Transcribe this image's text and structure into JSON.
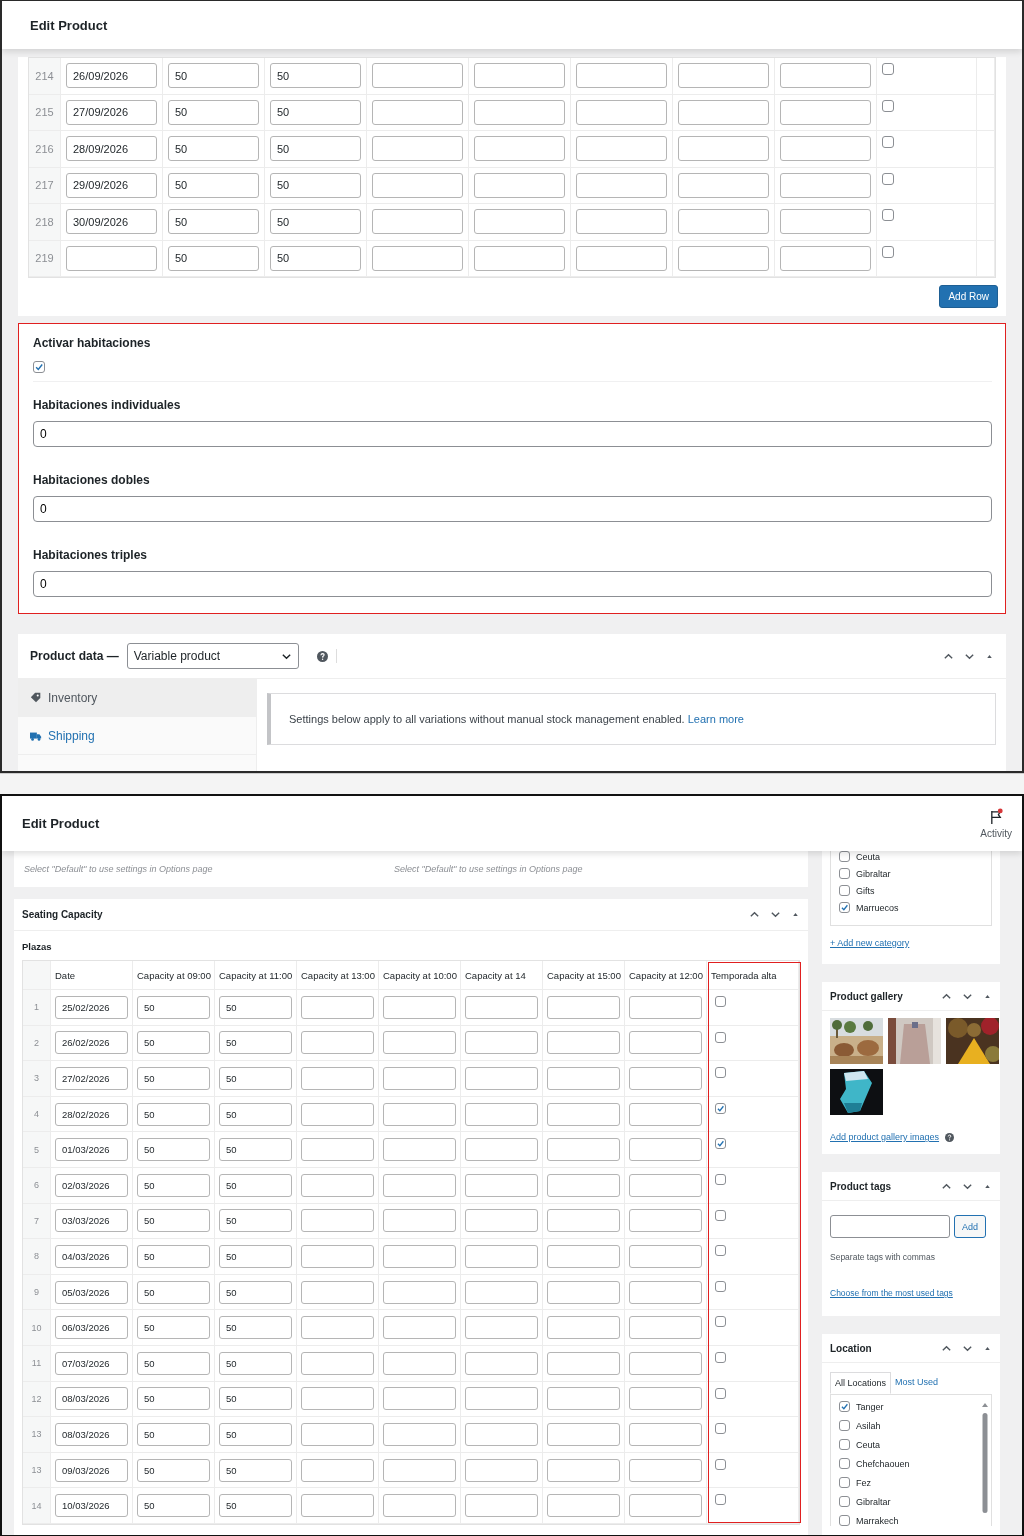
{
  "top_screen": {
    "title": "Edit Product",
    "rows": [
      {
        "number": "214",
        "date": "26/09/2026",
        "capacities": [
          "50",
          "50"
        ],
        "checked": false
      },
      {
        "number": "215",
        "date": "27/09/2026",
        "capacities": [
          "50",
          "50"
        ],
        "checked": false
      },
      {
        "number": "216",
        "date": "28/09/2026",
        "capacities": [
          "50",
          "50"
        ],
        "checked": false
      },
      {
        "number": "217",
        "date": "29/09/2026",
        "capacities": [
          "50",
          "50"
        ],
        "checked": false
      },
      {
        "number": "218",
        "date": "30/09/2026",
        "capacities": [
          "50",
          "50"
        ],
        "checked": false
      },
      {
        "number": "219",
        "capacities": [
          "50",
          "50"
        ],
        "checked": false
      }
    ],
    "add_row_button": "Add Row",
    "rooms": {
      "activate": {
        "label": "Activar habitaciones",
        "checked": true
      },
      "fields": [
        {
          "label": "Habitaciones individuales",
          "value": "0"
        },
        {
          "label": "Habitaciones dobles",
          "value": "0"
        },
        {
          "label": "Habitaciones triples",
          "value": "0"
        }
      ]
    },
    "product_data": {
      "label": "Product data —",
      "type": "Variable product",
      "tabs": [
        {
          "label": "Inventory",
          "kind": "inventory",
          "selected": true
        },
        {
          "label": "Shipping",
          "kind": "shipping",
          "selected": false
        }
      ],
      "notice": "Settings below apply to all variations without manual stock management enabled.",
      "notice_link": "Learn more"
    }
  },
  "bottom_screen": {
    "title": "Edit Product",
    "activity": {
      "label": "Activity",
      "unread": true
    },
    "hints": [
      "Select \"Default\" to use settings in Options page",
      "Select \"Default\" to use settings in Options page"
    ],
    "seating": {
      "title": "Seating Capacity",
      "subtitle": "Plazas",
      "columns": [
        "Date",
        "Capacity at 09:00",
        "Capacity at 11:00",
        "Capacity at 13:00",
        "Capacity at 10:00",
        "Capacity at 14",
        "Capacity at 15:00",
        "Capacity at 12:00",
        "Temporada alta"
      ],
      "rows": [
        {
          "number": "1",
          "date": "25/02/2026",
          "capacities": [
            "50",
            "50"
          ],
          "checked": false
        },
        {
          "number": "2",
          "date": "26/02/2026",
          "capacities": [
            "50",
            "50"
          ],
          "checked": false
        },
        {
          "number": "3",
          "date": "27/02/2026",
          "capacities": [
            "50",
            "50"
          ],
          "checked": false
        },
        {
          "number": "4",
          "date": "28/02/2026",
          "capacities": [
            "50",
            "50"
          ],
          "checked": true
        },
        {
          "number": "5",
          "date": "01/03/2026",
          "capacities": [
            "50",
            "50"
          ],
          "checked": true
        },
        {
          "number": "6",
          "date": "02/03/2026",
          "capacities": [
            "50",
            "50"
          ],
          "checked": false
        },
        {
          "number": "7",
          "date": "03/03/2026",
          "capacities": [
            "50",
            "50"
          ],
          "checked": false
        },
        {
          "number": "8",
          "date": "04/03/2026",
          "capacities": [
            "50",
            "50"
          ],
          "checked": false
        },
        {
          "number": "9",
          "date": "05/03/2026",
          "capacities": [
            "50",
            "50"
          ],
          "checked": false
        },
        {
          "number": "10",
          "date": "06/03/2026",
          "capacities": [
            "50",
            "50"
          ],
          "checked": false
        },
        {
          "number": "11",
          "date": "07/03/2026",
          "capacities": [
            "50",
            "50"
          ],
          "checked": false
        },
        {
          "number": "12",
          "date": "08/03/2026",
          "capacities": [
            "50",
            "50"
          ],
          "checked": false
        },
        {
          "number": "13",
          "date": "08/03/2026",
          "capacities": [
            "50",
            "50"
          ],
          "checked": false
        },
        {
          "number": "13",
          "date": "09/03/2026",
          "capacities": [
            "50",
            "50"
          ],
          "checked": false
        },
        {
          "number": "14",
          "date": "10/03/2026",
          "capacities": [
            "50",
            "50"
          ],
          "checked": false
        }
      ]
    },
    "sidebar": {
      "categories": {
        "items": [
          {
            "label": "Ceuta",
            "checked": false
          },
          {
            "label": "Gibraltar",
            "checked": false
          },
          {
            "label": "Gifts",
            "checked": false
          },
          {
            "label": "Marruecos",
            "checked": true
          }
        ],
        "add_link": "+ Add new category"
      },
      "gallery": {
        "title": "Product gallery",
        "add_link": "Add product gallery images"
      },
      "tags": {
        "title": "Product tags",
        "add_button": "Add",
        "hint": "Separate tags with commas",
        "link": "Choose from the most used tags"
      },
      "location": {
        "title": "Location",
        "tabs": [
          {
            "label": "All Locations",
            "selected": true
          },
          {
            "label": "Most Used",
            "selected": false
          }
        ],
        "items": [
          {
            "label": "Tanger",
            "checked": true
          },
          {
            "label": "Asilah",
            "checked": false
          },
          {
            "label": "Ceuta",
            "checked": false
          },
          {
            "label": "Chefchaouen",
            "checked": false
          },
          {
            "label": "Fez",
            "checked": false
          },
          {
            "label": "Gibraltar",
            "checked": false
          },
          {
            "label": "Marrakech",
            "checked": false
          }
        ]
      }
    }
  }
}
